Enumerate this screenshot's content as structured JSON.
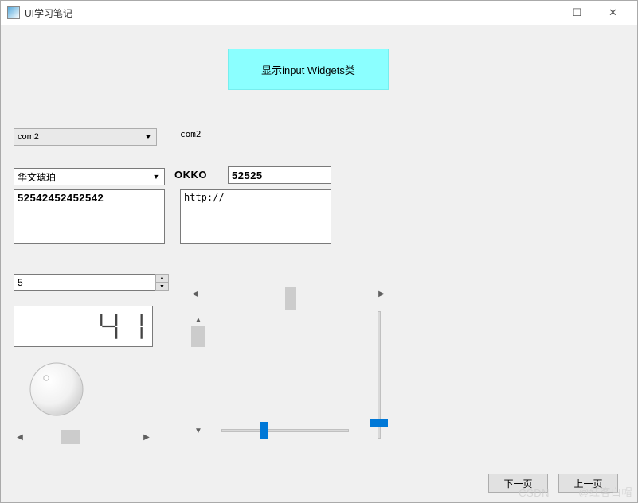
{
  "window": {
    "title": "UI学习笔记"
  },
  "banner": {
    "text": "显示input Widgets类"
  },
  "combo1": {
    "value": "com2",
    "echo_label": "com2"
  },
  "fontcombo": {
    "value": "华文琥珀"
  },
  "okko_label": "OKKO",
  "lineedit": {
    "value": "52525"
  },
  "textedit1": {
    "value": "52542452452542"
  },
  "textedit2": {
    "value": "http://"
  },
  "spinbox": {
    "value": "5"
  },
  "lcd": {
    "value": "41"
  },
  "dial": {
    "value": 15
  },
  "hscroll_top": {
    "pos": 0.5
  },
  "vscroll": {
    "pos": 0.0
  },
  "hscroll_small": {
    "pos": 0.35
  },
  "slider_h": {
    "pos": 0.3
  },
  "slider_v": {
    "pos": 0.85
  },
  "buttons": {
    "next": "下一页",
    "prev": "上一页"
  },
  "watermark": {
    "left": "CSDN",
    "right": "@红客白帽"
  }
}
